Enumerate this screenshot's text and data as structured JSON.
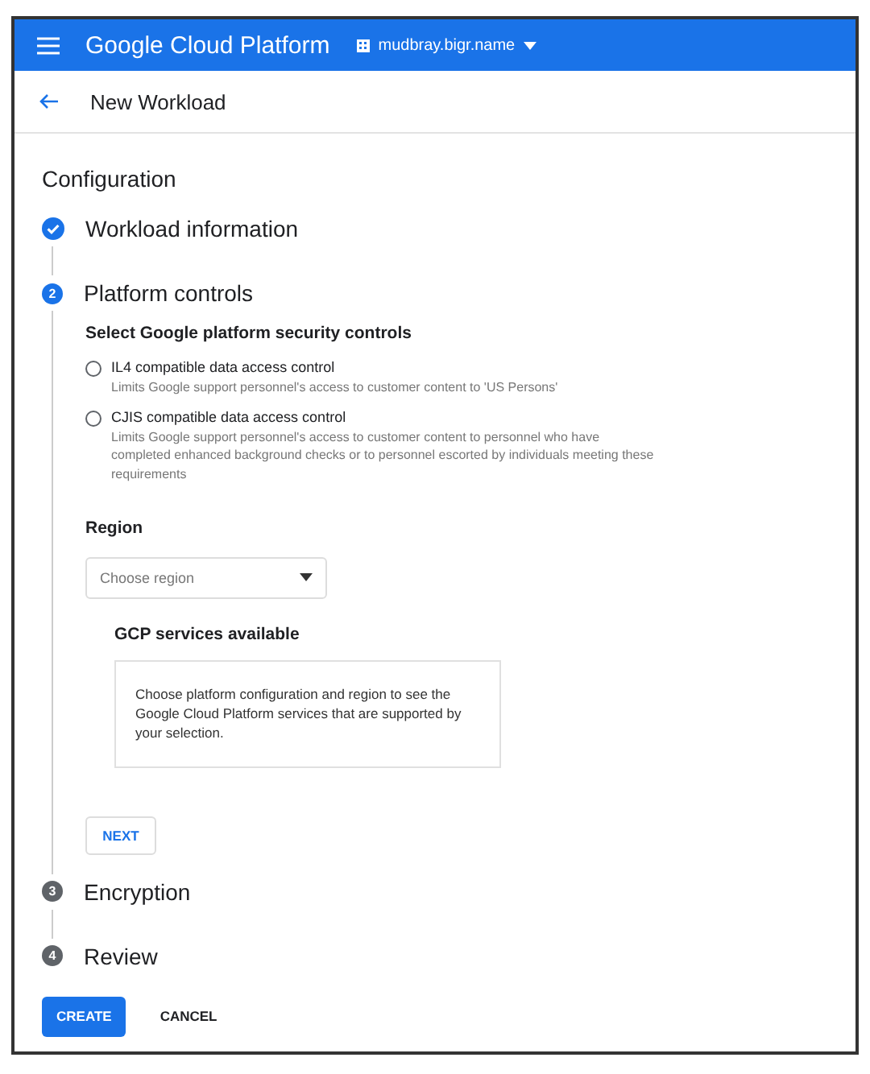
{
  "topbar": {
    "product": "Google Cloud Platform",
    "project": "mudbray.bigr.name"
  },
  "header": {
    "title": "New Workload"
  },
  "section_title": "Configuration",
  "steps": [
    {
      "title": "Workload information",
      "completed": true,
      "selected": false
    },
    {
      "number": "2",
      "title": "Platform controls",
      "completed": false,
      "selected": true
    },
    {
      "number": "3",
      "title": "Encryption",
      "completed": false,
      "selected": false
    },
    {
      "number": "4",
      "title": "Review",
      "completed": false,
      "selected": false
    }
  ],
  "platform_controls": {
    "heading": "Select Google platform security controls",
    "options": [
      {
        "label": "IL4 compatible data access control",
        "description": "Limits Google support personnel's access to customer content to 'US Persons'",
        "selected": false
      },
      {
        "label": "CJIS compatible data access control",
        "description": "Limits Google support personnel's access to customer content to personnel who have completed enhanced background checks or to personnel escorted by individuals meeting these requirements",
        "selected": false
      }
    ],
    "region_label": "Region",
    "region_select": {
      "placeholder": "Choose region"
    },
    "services": {
      "title": "GCP services available",
      "message": "Choose platform configuration and region to see the Google Cloud Platform services that are supported by your selection."
    },
    "next_button": "NEXT"
  },
  "actions": [
    "CREATE",
    "CANCEL"
  ]
}
